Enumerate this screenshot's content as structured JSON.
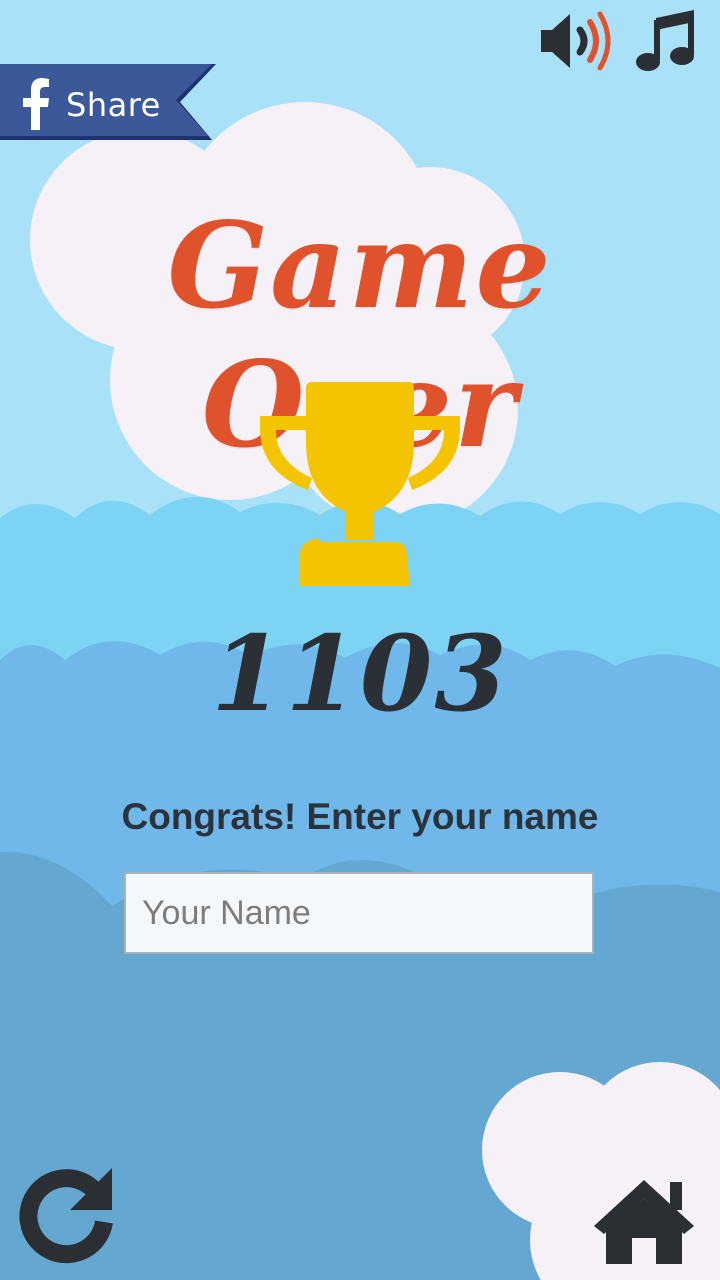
{
  "share": {
    "label": "Share",
    "icon": "facebook-icon",
    "color": "#3b5998"
  },
  "controls": {
    "sound_icon": "speaker-icon",
    "music_icon": "music-note-icon"
  },
  "title": "Game Over",
  "score": "1103",
  "prompt": "Congrats! Enter your name",
  "name_input": {
    "placeholder": "Your Name",
    "value": ""
  },
  "footer": {
    "replay_icon": "replay-icon",
    "home_icon": "home-icon"
  },
  "colors": {
    "sky": "#a9e2f8",
    "title": "#e0522b",
    "trophy": "#f5c400",
    "text_dark": "#2b333c",
    "cloud": "#f6f1f6"
  }
}
